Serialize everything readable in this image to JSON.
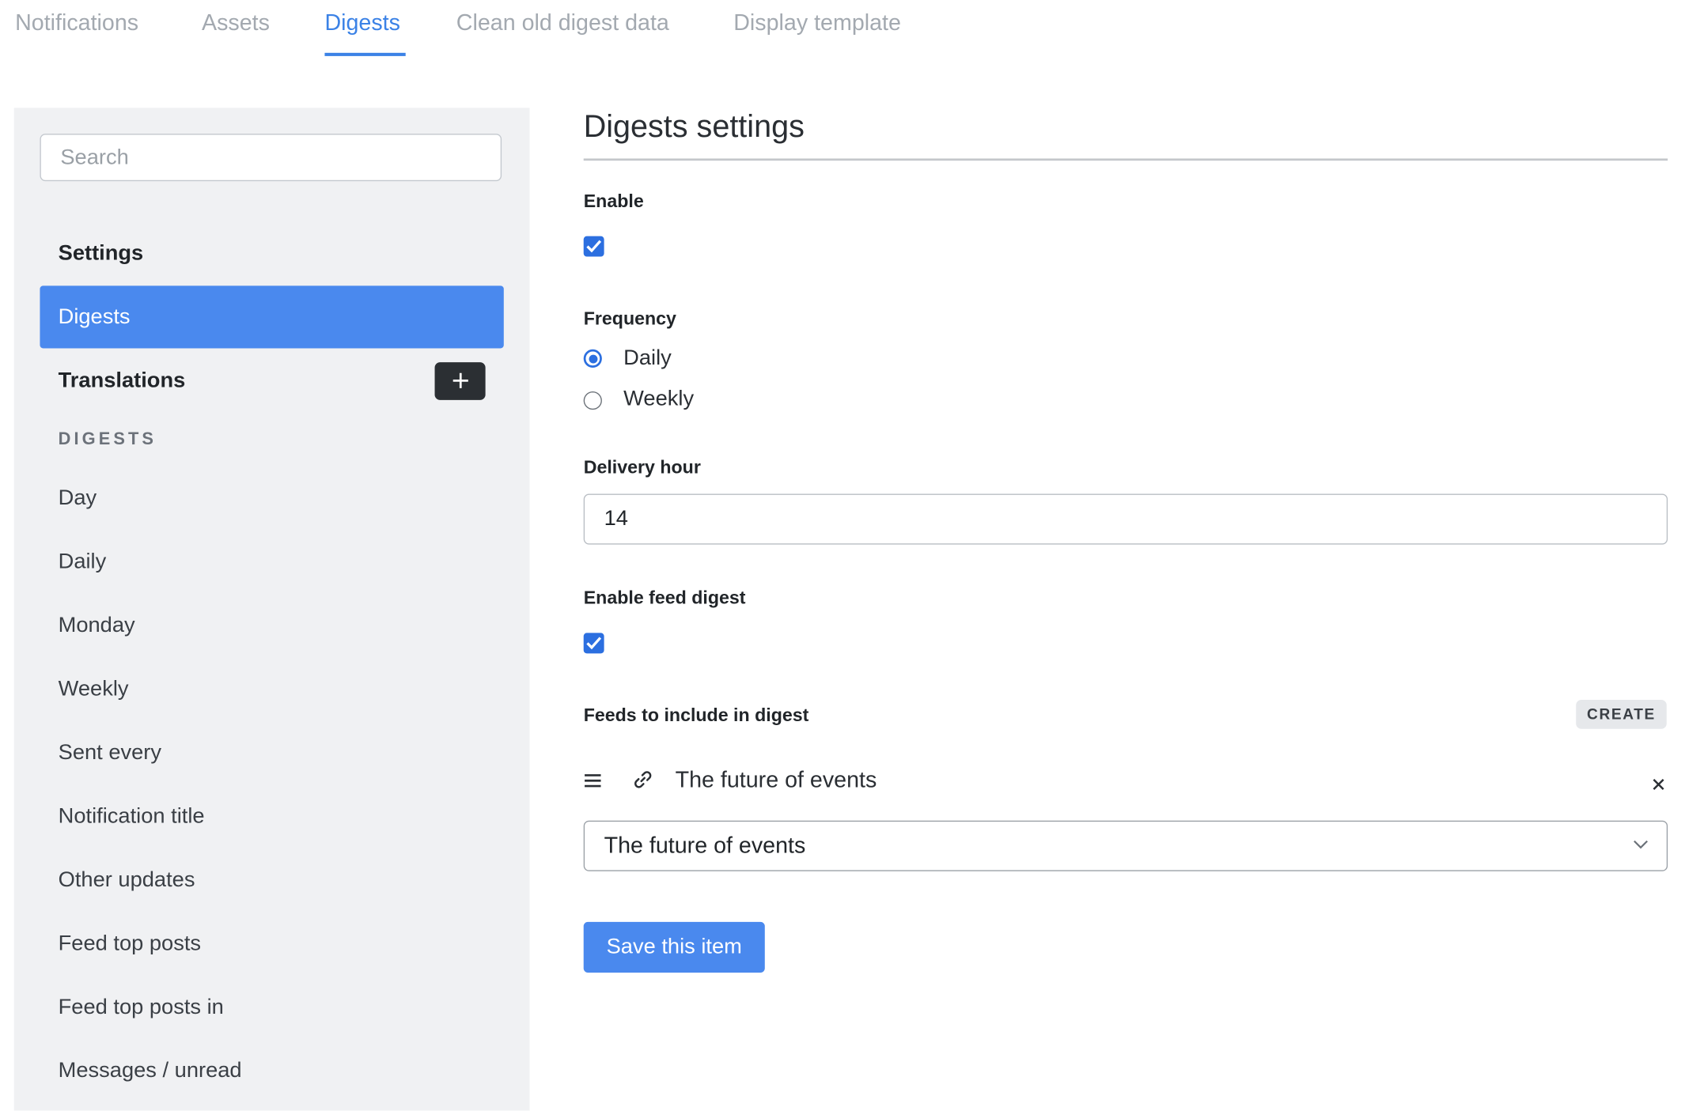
{
  "tabs": [
    {
      "label": "Notifications"
    },
    {
      "label": "Assets"
    },
    {
      "label": "Digests"
    },
    {
      "label": "Clean old digest data"
    },
    {
      "label": "Display template"
    }
  ],
  "active_tab": "Digests",
  "sidebar": {
    "search_placeholder": "Search",
    "settings_heading": "Settings",
    "active_item": "Digests",
    "translations_heading": "Translations",
    "section_label": "DIGESTS",
    "items": [
      {
        "label": "Day"
      },
      {
        "label": "Daily"
      },
      {
        "label": "Monday"
      },
      {
        "label": "Weekly"
      },
      {
        "label": "Sent every"
      },
      {
        "label": "Notification title"
      },
      {
        "label": "Other updates"
      },
      {
        "label": "Feed top posts"
      },
      {
        "label": "Feed top posts in"
      },
      {
        "label": "Messages / unread"
      }
    ]
  },
  "main": {
    "title": "Digests settings",
    "enable_label": "Enable",
    "enable_checked": true,
    "frequency_label": "Frequency",
    "frequency_options": [
      {
        "label": "Daily",
        "selected": true
      },
      {
        "label": "Weekly",
        "selected": false
      }
    ],
    "delivery_hour_label": "Delivery hour",
    "delivery_hour_value": "14",
    "feed_digest_label": "Enable feed digest",
    "feed_digest_checked": true,
    "feeds_label": "Feeds to include in digest",
    "create_label": "CREATE",
    "feed_item_title": "The future of events",
    "feed_select_value": "The future of events",
    "save_label": "Save this item"
  },
  "colors": {
    "accent": "#4a89ee",
    "tab_active": "#3b82e6",
    "sidebar_bg": "#f0f1f3",
    "checkbox": "#2c6fe0"
  }
}
